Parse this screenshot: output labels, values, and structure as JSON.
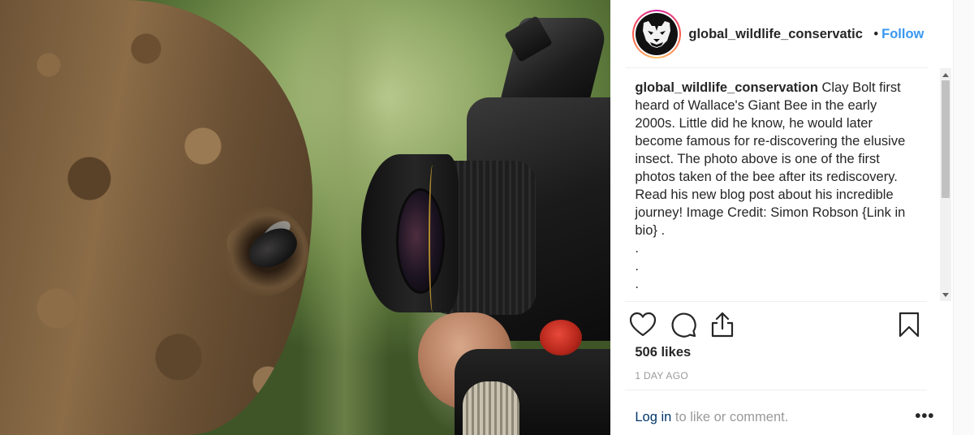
{
  "header": {
    "username": "global_wildlife_conservatic",
    "separator": "•",
    "follow_label": "Follow"
  },
  "caption": {
    "username": "global_wildlife_conservation",
    "text": " Clay Bolt first heard of Wallace's Giant Bee in the early 2000s. Little did he know, he would later become famous for re-discovering the elusive insect. The photo above is one of the first photos taken of the bee after its rediscovery. Read his new blog post about his incredible journey! Image Credit: Simon Robson {Link in bio} .",
    "dots": [
      ".",
      ".",
      "."
    ]
  },
  "actions": {
    "like_icon": "heart-icon",
    "comment_icon": "comment-icon",
    "share_icon": "share-icon",
    "save_icon": "bookmark-icon"
  },
  "likes": "506 likes",
  "timestamp": "1 DAY AGO",
  "comment_row": {
    "login_label": "Log in",
    "suffix": " to like or comment.",
    "more_label": "•••"
  },
  "colors": {
    "link_blue": "#3897f0",
    "text": "#262626",
    "muted": "#999999",
    "divider": "#efefef"
  }
}
